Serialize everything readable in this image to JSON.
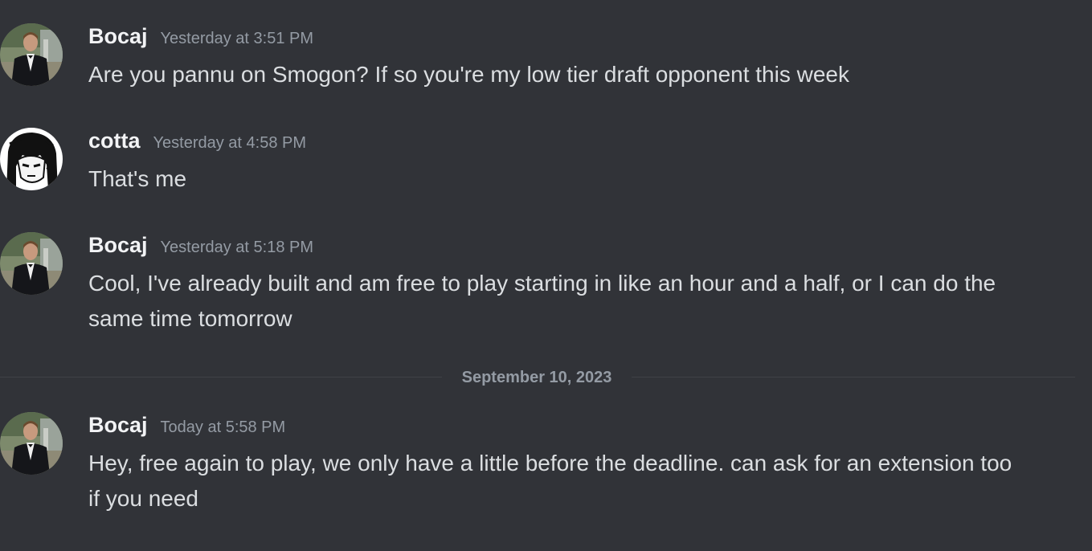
{
  "messages": [
    {
      "username": "Bocaj",
      "timestamp": "Yesterday at 3:51 PM",
      "text": "Are you pannu on Smogon? If so you're my low tier draft opponent this week",
      "avatar_icon": "man-in-tuxedo-avatar-icon"
    },
    {
      "username": "cotta",
      "timestamp": "Yesterday at 4:58 PM",
      "text": "That's me",
      "avatar_icon": "manga-character-avatar-icon"
    },
    {
      "username": "Bocaj",
      "timestamp": "Yesterday at 5:18 PM",
      "text": "Cool, I've already built and am free to play starting in like an hour and a half, or I can do the same time tomorrow",
      "avatar_icon": "man-in-tuxedo-avatar-icon"
    },
    {
      "username": "Bocaj",
      "timestamp": "Today at 5:58 PM",
      "text": "Hey, free again to play, we only have a little before the deadline. can ask for an extension too if you need",
      "avatar_icon": "man-in-tuxedo-avatar-icon"
    }
  ],
  "date_divider": "September 10, 2023",
  "colors": {
    "background": "#313338",
    "username": "#f2f3f5",
    "timestamp": "#949ba4",
    "message_text": "#dbdee1",
    "divider": "#3f4147"
  }
}
